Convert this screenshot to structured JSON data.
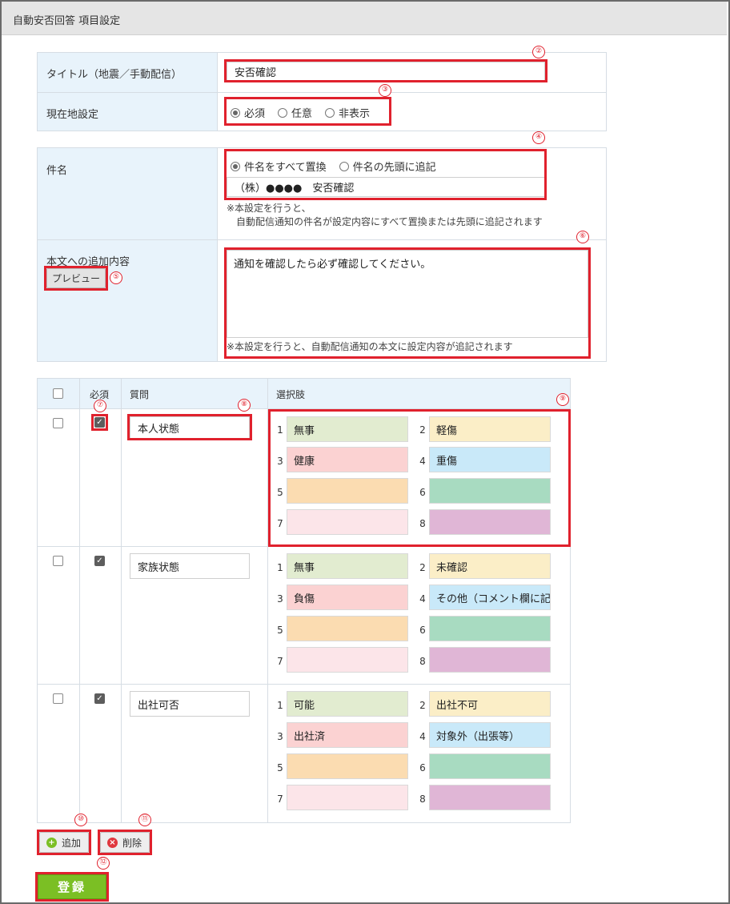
{
  "header": {
    "title": "自動安否回答 項目設定"
  },
  "form": {
    "title_row": {
      "label": "タイトル（地震／手動配信）",
      "value": "安否確認"
    },
    "location_row": {
      "label": "現在地設定",
      "options": [
        "必須",
        "任意",
        "非表示"
      ],
      "selected": "必須"
    },
    "subject_row": {
      "label": "件名",
      "options": [
        "件名をすべて置換",
        "件名の先頭に追記"
      ],
      "selected": "件名をすべて置換",
      "value": "（株）●●●●　安否確認",
      "note_line1": "※本設定を行うと、",
      "note_line2": "自動配信通知の件名が設定内容にすべて置換または先頭に追記されます"
    },
    "body_row": {
      "label": "本文への追加内容",
      "preview_label": "プレビュー",
      "value": "通知を確認したら必ず確認してください。",
      "note": "※本設定を行うと、自動配信通知の本文に設定内容が追記されます"
    }
  },
  "table": {
    "headers": {
      "required": "必須",
      "question": "質問",
      "choices": "選択肢"
    },
    "rows": [
      {
        "question": "本人状態",
        "required": true,
        "choices": [
          "無事",
          "軽傷",
          "健康",
          "重傷",
          "",
          "",
          "",
          ""
        ]
      },
      {
        "question": "家族状態",
        "required": true,
        "choices": [
          "無事",
          "未確認",
          "負傷",
          "その他（コメント欄に記",
          "",
          "",
          "",
          ""
        ]
      },
      {
        "question": "出社可否",
        "required": true,
        "choices": [
          "可能",
          "出社不可",
          "出社済",
          "対象外（出張等）",
          "",
          "",
          "",
          ""
        ]
      }
    ],
    "choice_numbers": [
      "1",
      "2",
      "3",
      "4",
      "5",
      "6",
      "7",
      "8"
    ],
    "choice_colors": [
      "#e2ecd0",
      "#fbeec7",
      "#fbd2d2",
      "#c9e9f9",
      "#fbdcb1",
      "#a8dbc1",
      "#fce5e9",
      "#e0b6d6"
    ]
  },
  "actions": {
    "add_label": "追加",
    "delete_label": "削除",
    "submit_label": "登録"
  },
  "markers": [
    "②",
    "③",
    "④",
    "⑤",
    "⑥",
    "⑦",
    "⑧",
    "⑨",
    "⑩",
    "⑪",
    "⑫"
  ],
  "accent": {
    "highlight": "#e0212d",
    "submit": "#7bbf24"
  }
}
